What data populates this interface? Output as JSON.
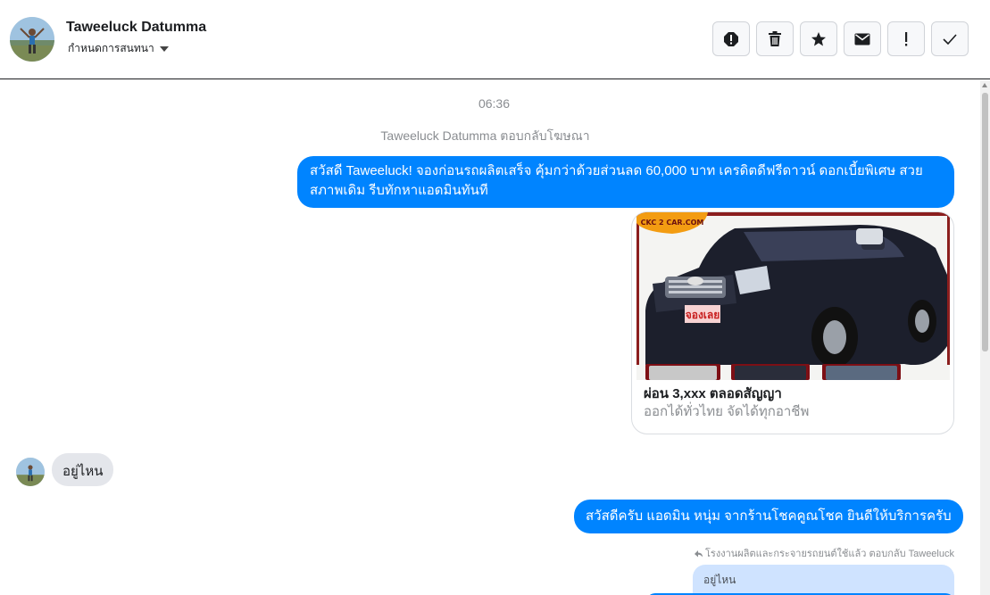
{
  "header": {
    "name": "Taweeluck Datumma",
    "assign_label": "กำหนดการสนทนา",
    "actions": [
      {
        "name": "report-icon"
      },
      {
        "name": "trash-icon"
      },
      {
        "name": "star-icon"
      },
      {
        "name": "envelope-icon"
      },
      {
        "name": "exclamation-icon"
      },
      {
        "name": "checkmark-icon"
      }
    ]
  },
  "thread": {
    "time": "06:36",
    "replied_note": "Taweeluck Datumma ตอบกลับโฆษณา",
    "message_1": "สวัสดี Taweeluck! จองก่อนรถผลิตเสร็จ คุ้มกว่าด้วยส่วนลด 60,000 บาท เครดิตดีฟรีดาวน์ ดอกเบี้ยพิเศษ สวยสภาพเดิม รีบทักหาแอดมินทันที",
    "card": {
      "image_badge": "CKC 2 CAR.COM",
      "image_sticker": "จองเลย",
      "title": "ผ่อน 3,xxx ตลอดสัญญา",
      "subtitle": "ออกได้ทั่วไทย จัดได้ทุกอาชีพ"
    },
    "incoming_1": "อยู่ไหน",
    "message_2": "สวัสดีครับ แอดมิน หนุ่ม จากร้านโชคคูณโชค ยินดีให้บริการครับ",
    "reply_ref": "โรงงานผลิตและกระจายรถยนต์ใช้แล้ว ตอบกลับ Taweeluck",
    "quoted": "อยู่ไหน"
  },
  "colors": {
    "outgoing": "#0084ff",
    "incoming": "#e4e6eb",
    "quoted": "#cfe3ff"
  }
}
